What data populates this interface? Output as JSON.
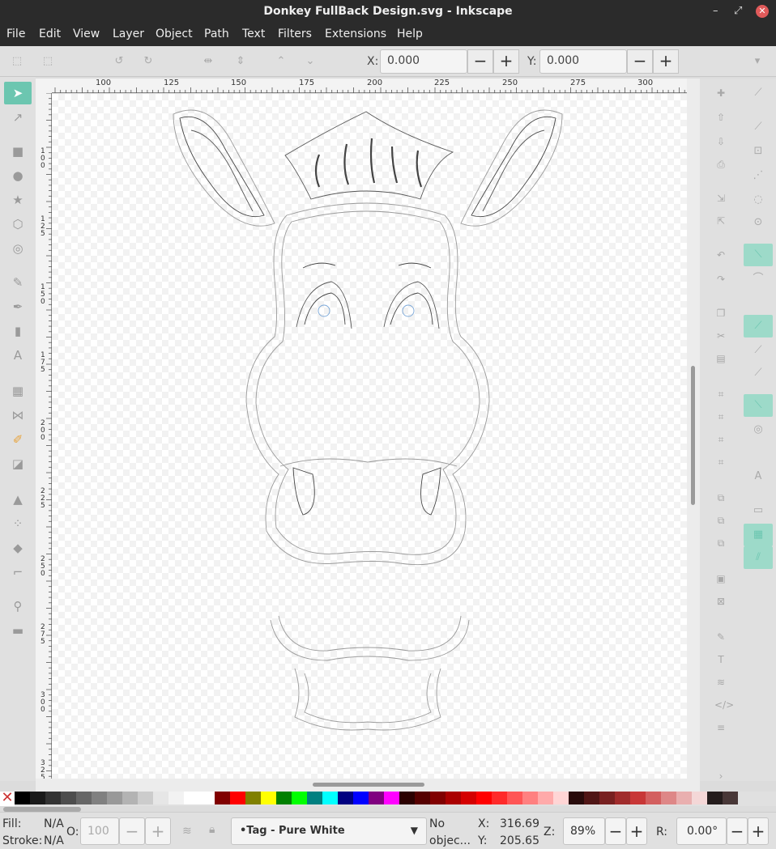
{
  "window": {
    "title": "Donkey FullBack Design.svg - Inkscape",
    "controls": [
      "–",
      "⤢",
      "✕"
    ]
  },
  "menu": [
    "File",
    "Edit",
    "View",
    "Layer",
    "Object",
    "Path",
    "Text",
    "Filters",
    "Extensions",
    "Help"
  ],
  "toolbar": {
    "x_label": "X:",
    "x_value": "0.000",
    "y_label": "Y:",
    "y_value": "0.000",
    "minus": "−",
    "plus": "+"
  },
  "ruler": {
    "h_ticks": [
      "100",
      "125",
      "150",
      "175",
      "200",
      "225",
      "250",
      "275",
      "300"
    ],
    "v_ticks": [
      "100",
      "125",
      "150",
      "175",
      "200",
      "225",
      "250",
      "275",
      "300",
      "325"
    ]
  },
  "colors": {
    "accent": "#6cc6b0",
    "accent_light": "#9ddac9",
    "canvas": "#ffffff",
    "chrome": "#2b2b2b"
  },
  "palette": [
    "#000000",
    "#1a1a1a",
    "#333333",
    "#4d4d4d",
    "#666666",
    "#808080",
    "#999999",
    "#b3b3b3",
    "#cccccc",
    "#e6e6e6",
    "#f2f2f2",
    "#ffffff",
    "#ffffff",
    "#800000",
    "#ff0000",
    "#808000",
    "#ffff00",
    "#008000",
    "#00ff00",
    "#008080",
    "#00ffff",
    "#000080",
    "#0000ff",
    "#800080",
    "#ff00ff",
    "#2b0000",
    "#550000",
    "#800000",
    "#aa0000",
    "#d40000",
    "#ff0000",
    "#ff2a2a",
    "#ff5555",
    "#ff8080",
    "#ffaaaa",
    "#ffd5d5",
    "#280b0b",
    "#501616",
    "#782121",
    "#a02c2c",
    "#c83737",
    "#d35f5f",
    "#de8787",
    "#e9afaf",
    "#f4d7d7",
    "#241c1c",
    "#483737"
  ],
  "status": {
    "fill_label": "Fill:",
    "fill_value": "N/A",
    "stroke_label": "Stroke:",
    "stroke_value": "N/A",
    "opacity_label": "O:",
    "opacity_value": "100",
    "layer": "•Tag - Pure White",
    "message_line1": "No",
    "message_line2": "objec...",
    "cx_label": "X:",
    "cx_value": "316.69",
    "cy_label": "Y:",
    "cy_value": "205.65",
    "zoom_label": "Z:",
    "zoom_value": "89%",
    "rot_label": "R:",
    "rot_value": "0.00°",
    "minus": "−",
    "plus": "+"
  }
}
